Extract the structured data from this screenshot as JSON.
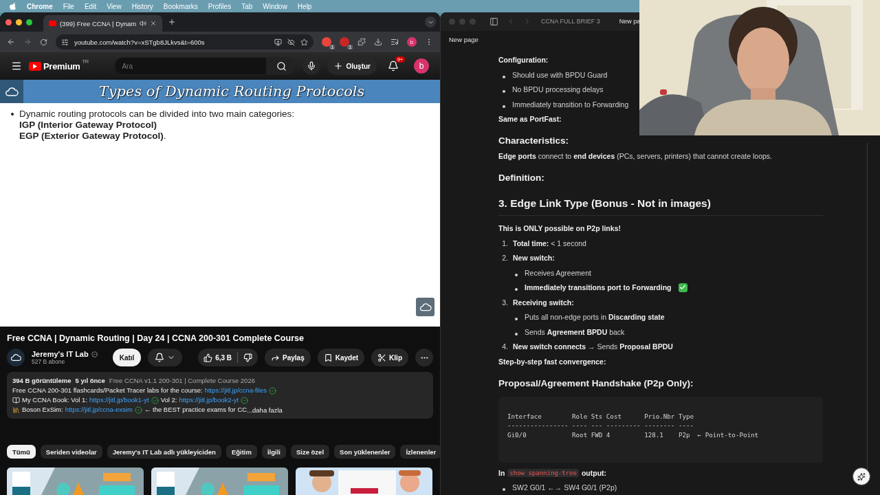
{
  "menu_bar": {
    "app": "Chrome",
    "items": [
      "File",
      "Edit",
      "View",
      "History",
      "Bookmarks",
      "Profiles",
      "Tab",
      "Window",
      "Help"
    ]
  },
  "browser": {
    "tabs": [
      {
        "title": "(399) Free CCNA | Dynam",
        "selected": true
      }
    ],
    "address": "youtube.com/watch?v=xSTgb8JLkvs&t=600s",
    "extension_badges": [
      "1",
      "1"
    ],
    "profile": "b"
  },
  "youtube": {
    "logo": "Premium",
    "region": "TR",
    "search": {
      "placeholder": "Ara"
    },
    "create": "Oluştur",
    "notifications": "9+",
    "avatar": "b",
    "slide": {
      "title": "Types of Dynamic Routing Protocols",
      "bullet": "Dynamic routing protocols can be divided into two main categories:",
      "lines": [
        "**IGP (Interior Gateway Protocol)**",
        "**EGP (Exterior Gateway Protocol)**."
      ]
    },
    "title": "Free CCNA | Dynamic Routing | Day 24 | CCNA 200-301 Complete Course",
    "channel": {
      "name": "Jeremy's IT Lab",
      "subscribers": "527 B abone"
    },
    "join": "Katıl",
    "likes": "6,3 B",
    "share": "Paylaş",
    "save": "Kaydet",
    "clip": "Klip",
    "description": {
      "views": "394 B görüntüleme",
      "age": "5 yıl önce",
      "playlist": "Free CCNA v1.1 200-301 | Complete Course 2026",
      "lines": [
        [
          {
            "kind": "text",
            "text": "Free CCNA 200-301 flashcards/Packet Tracer labs for the course:"
          },
          {
            "kind": "link",
            "text": "https://jitl.jp/ccna-files"
          },
          {
            "kind": "check"
          }
        ],
        [
          {
            "kind": "book"
          },
          {
            "kind": "text",
            "text": "My CCNA Book: Vol 1:"
          },
          {
            "kind": "link",
            "text": "https://jitl.jp/book1-yt"
          },
          {
            "kind": "check"
          },
          {
            "kind": "text",
            "text": "Vol 2:"
          },
          {
            "kind": "link",
            "text": "https://jitl.jp/book2-yt"
          },
          {
            "kind": "check"
          }
        ],
        [
          {
            "kind": "books"
          },
          {
            "kind": "text",
            "text": "Boson ExSim:"
          },
          {
            "kind": "link",
            "text": "https://jitl.jp/ccna-exsim"
          },
          {
            "kind": "check"
          },
          {
            "kind": "text",
            "text": "← the BEST practice exams for CC"
          },
          {
            "kind": "more",
            "text": "...daha fazla"
          }
        ]
      ]
    },
    "chips": [
      {
        "label": "Tümü",
        "selected": true
      },
      {
        "label": "Seriden videolar",
        "selected": false
      },
      {
        "label": "Jeremy's IT Lab adlı yükleyiciden",
        "selected": false
      },
      {
        "label": "Eğitim",
        "selected": false
      },
      {
        "label": "İlgili",
        "selected": false
      },
      {
        "label": "Size özel",
        "selected": false
      },
      {
        "label": "Son yüklenenler",
        "selected": false
      },
      {
        "label": "İzlenenler",
        "selected": false
      }
    ]
  },
  "notes": {
    "window_title": "CCNA FULL BRIEF 3",
    "tab": "New pa",
    "breadcrumb": "New page",
    "blocks": [
      {
        "kind": "label",
        "text": "Configuration:"
      },
      {
        "kind": "bullet",
        "text": "Should use with BPDU Guard"
      },
      {
        "kind": "bullet",
        "text": "No BPDU processing delays"
      },
      {
        "kind": "bullet",
        "text": "Immediately transition to Forwarding"
      },
      {
        "kind": "label",
        "text": "Same as PortFast:"
      },
      {
        "kind": "h3",
        "text": "Characteristics:"
      },
      {
        "kind": "para",
        "text": "**Edge ports** connect to **end devices** (PCs, servers, printers) that cannot create loops."
      },
      {
        "kind": "h3",
        "text": "Definition:"
      },
      {
        "kind": "h2",
        "text": "3. Edge Link Type (Bonus - Not in images)"
      },
      {
        "kind": "label",
        "text": "This is ONLY possible on P2p links!"
      },
      {
        "kind": "num",
        "number": "1.",
        "text": "**Total time:** < 1 second"
      },
      {
        "kind": "num",
        "number": "2.",
        "text": "**New switch:**"
      },
      {
        "kind": "sub",
        "text": "Receives Agreement",
        "done": false
      },
      {
        "kind": "sub",
        "text": "**Immediately transitions port to Forwarding**",
        "done": true
      },
      {
        "kind": "num",
        "number": "3.",
        "text": "**Receiving switch:**"
      },
      {
        "kind": "sub",
        "text": "Puts all non-edge ports in **Discarding state**",
        "done": false
      },
      {
        "kind": "sub",
        "text": "Sends **Agreement BPDU** back",
        "done": false
      },
      {
        "kind": "num",
        "number": "4.",
        "text": "**New switch connects** → Sends **Proposal BPDU**"
      },
      {
        "kind": "label",
        "text": "Step-by-step fast convergence:"
      },
      {
        "kind": "h3",
        "text": "Proposal/Agreement Handshake (P2p Only):"
      },
      {
        "kind": "code",
        "lines": [
          "Interface        Role Sts Cost      Prio.Nbr Type",
          "---------------- ---- --- --------- -------- ----",
          "Gi0/0            Root FWD 4         128.1    P2p  ← Point-to-Point"
        ]
      },
      {
        "kind": "code-para",
        "before": "In",
        "code": "show spanning-tree",
        "after": "output:"
      },
      {
        "kind": "bullet",
        "text": "SW2 G0/1 ←→ SW4 G0/1 (P2p)"
      }
    ]
  }
}
